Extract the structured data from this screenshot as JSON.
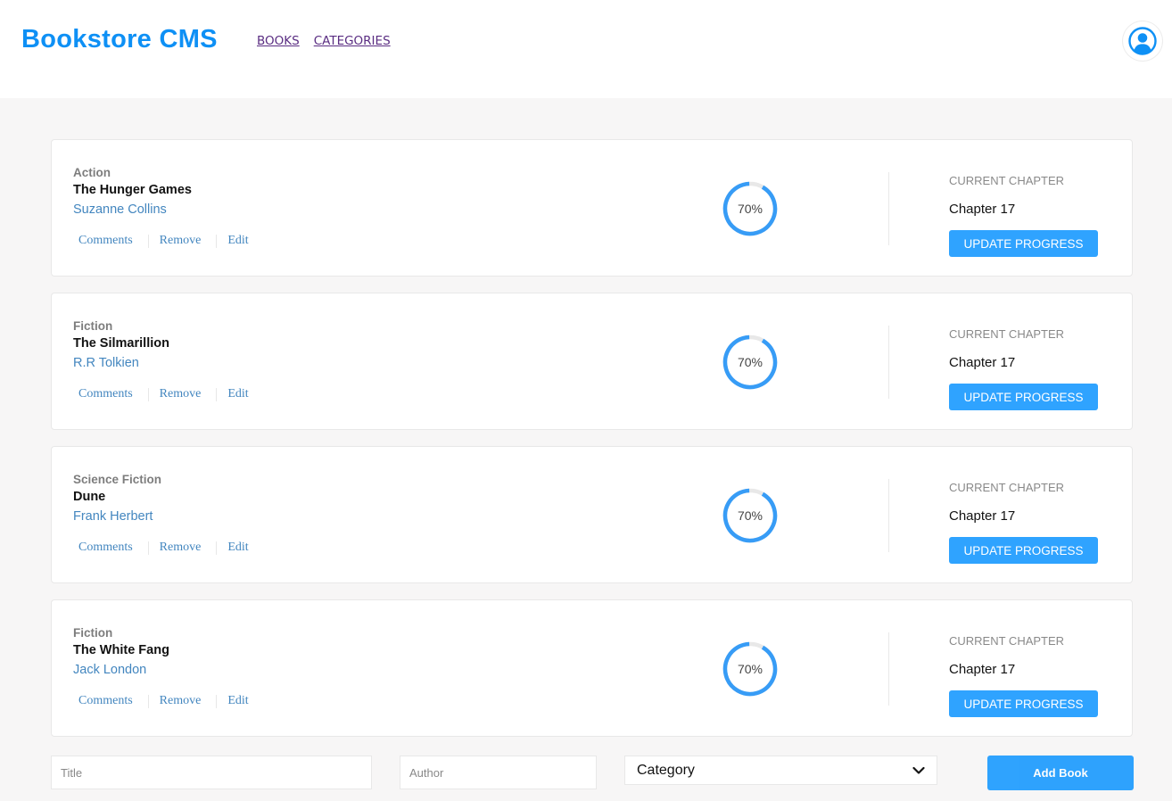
{
  "header": {
    "logo": "Bookstore CMS",
    "nav": [
      "BOOKS",
      "CATEGORIES"
    ]
  },
  "books": [
    {
      "category": "Action",
      "title": "The Hunger Games",
      "author": "Suzanne Collins",
      "progress": 70,
      "progress_label": "70%",
      "current_chapter_label": "CURRENT CHAPTER",
      "chapter": "Chapter 17",
      "update_label": "UPDATE PROGRESS",
      "actions": [
        "Comments",
        "Remove",
        "Edit"
      ]
    },
    {
      "category": "Fiction",
      "title": "The Silmarillion",
      "author": "R.R Tolkien",
      "progress": 70,
      "progress_label": "70%",
      "current_chapter_label": "CURRENT CHAPTER",
      "chapter": "Chapter 17",
      "update_label": "UPDATE PROGRESS",
      "actions": [
        "Comments",
        "Remove",
        "Edit"
      ]
    },
    {
      "category": "Science Fiction",
      "title": "Dune",
      "author": "Frank Herbert",
      "progress": 70,
      "progress_label": "70%",
      "current_chapter_label": "CURRENT CHAPTER",
      "chapter": "Chapter 17",
      "update_label": "UPDATE PROGRESS",
      "actions": [
        "Comments",
        "Remove",
        "Edit"
      ]
    },
    {
      "category": "Fiction",
      "title": "The White Fang",
      "author": "Jack London",
      "progress": 70,
      "progress_label": "70%",
      "current_chapter_label": "CURRENT CHAPTER",
      "chapter": "Chapter 17",
      "update_label": "UPDATE PROGRESS",
      "actions": [
        "Comments",
        "Remove",
        "Edit"
      ]
    }
  ],
  "form": {
    "title_placeholder": "Title",
    "title_value": "",
    "author_placeholder": "Author",
    "author_value": "",
    "category_selected": "Category",
    "add_label": "Add Book"
  },
  "colors": {
    "brand": "#0e90f5",
    "button": "#0290ff",
    "progress": "#379cf6",
    "link": "#4386bf",
    "nav_link": "#5a2d82"
  },
  "icons": {
    "avatar": "user-circle-icon",
    "select": "chevron-down-icon"
  }
}
